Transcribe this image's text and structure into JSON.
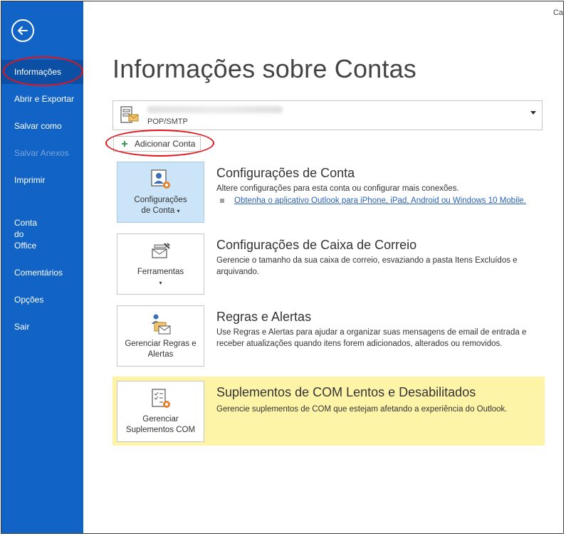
{
  "window": {
    "corner_text": "Ca"
  },
  "sidebar": {
    "back_icon": "arrow-left-icon",
    "items": [
      {
        "label": "Informações",
        "state": "active"
      },
      {
        "label": "Abrir e Exportar",
        "state": "normal"
      },
      {
        "label": "Salvar como",
        "state": "normal"
      },
      {
        "label": "Salvar Anexos",
        "state": "disabled"
      },
      {
        "label": "Imprimir",
        "state": "normal"
      },
      {
        "label": "Conta\ndo\nOffice",
        "state": "normal"
      },
      {
        "label": "Comentários",
        "state": "normal"
      },
      {
        "label": "Opções",
        "state": "normal"
      },
      {
        "label": "Sair",
        "state": "normal"
      }
    ]
  },
  "main": {
    "title": "Informações sobre Contas",
    "account": {
      "type": "POP/SMTP"
    },
    "add_account_label": "Adicionar Conta",
    "sections": [
      {
        "tile_label_1": "Configurações",
        "tile_label_2": "de Conta",
        "title": "Configurações de Conta",
        "description": "Altere configurações para esta conta ou configurar mais conexões.",
        "link": "Obtenha o aplicativo Outlook para iPhone, iPad, Android ou Windows 10 Mobile."
      },
      {
        "tile_label_1": "Ferramentas",
        "title": "Configurações de Caixa de Correio",
        "description": "Gerencie o tamanho da sua caixa de correio, esvaziando a pasta Itens Excluídos e arquivando."
      },
      {
        "tile_label_1": "Gerenciar Regras e",
        "tile_label_2": "Alertas",
        "title": "Regras e Alertas",
        "description": "Use Regras e Alertas para ajudar a organizar suas mensagens de email de entrada e receber atualizações quando itens forem adicionados, alterados ou removidos."
      },
      {
        "tile_label_1": "Gerenciar",
        "tile_label_2": "Suplementos COM",
        "title": "Suplementos de COM Lentos e Desabilitados",
        "description": "Gerencie suplementos de COM que estejam afetando a experiência do Outlook."
      }
    ]
  },
  "colors": {
    "sidebar": "#1163c5",
    "sidebar_active": "#0b50a5",
    "highlight": "#fef4a8",
    "annotation": "#e3141b",
    "link": "#2a63b8"
  }
}
